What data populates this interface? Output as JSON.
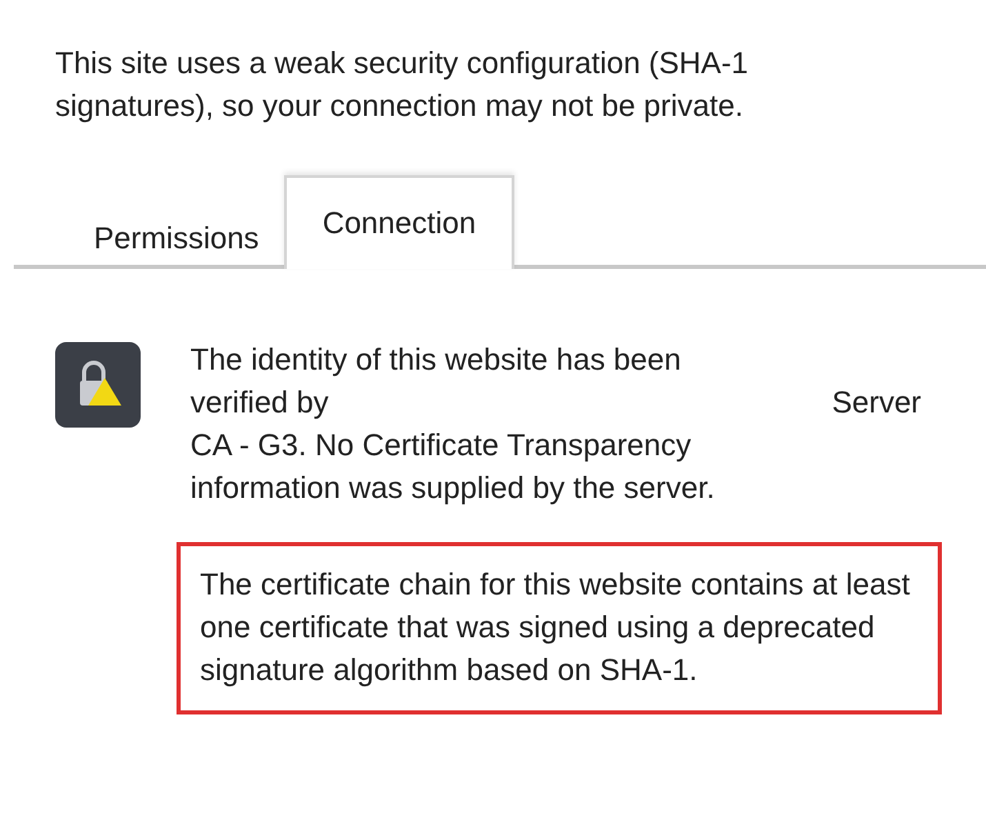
{
  "warning": {
    "text": "This site uses a weak security configuration (SHA-1 signatures), so your connection may not be private."
  },
  "tabs": [
    {
      "label": "Permissions",
      "selected": false
    },
    {
      "label": "Connection",
      "selected": true
    }
  ],
  "connection": {
    "identity_lines": [
      [
        "The identity of this website has been"
      ],
      [
        "verified by",
        "Server"
      ],
      [
        "CA - G3. No Certificate Transparency"
      ],
      [
        "information was supplied by the server."
      ]
    ],
    "notice": "The certificate chain for this website contains at least one certificate that was signed using a deprecated signature algorithm based on SHA-1."
  }
}
